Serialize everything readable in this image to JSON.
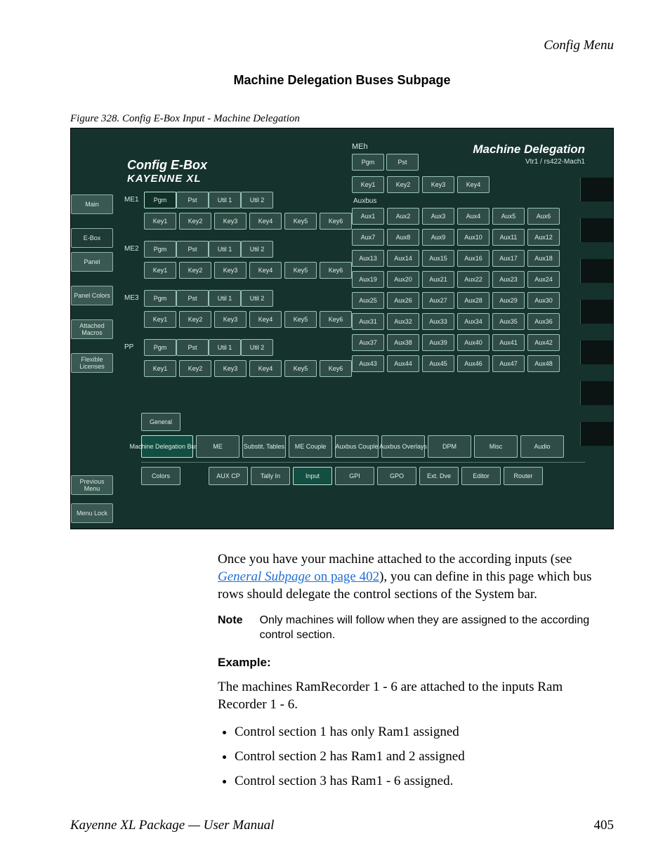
{
  "header": {
    "running": "Config Menu"
  },
  "section_title": "Machine Delegation Buses Subpage",
  "figure_caption": "Figure 328.  Config E-Box Input - Machine Delegation",
  "ui": {
    "title1": "Config E-Box",
    "title2": "KAYENNE XL",
    "sidebar": [
      "Main",
      "E-Box",
      "Panel",
      "Panel Colors",
      "Attached Macros",
      "Flexible Licenses"
    ],
    "sidebar_bottom": [
      "Previous Menu",
      "Menu Lock"
    ],
    "me_rows": [
      {
        "label": "ME1",
        "top": [
          "Pgm",
          "Pst",
          "Util 1",
          "Util 2"
        ],
        "keys": [
          "Key1",
          "Key2",
          "Key3",
          "Key4",
          "Key5",
          "Key6"
        ],
        "sel": 0
      },
      {
        "label": "ME2",
        "top": [
          "Pgm",
          "Pst",
          "Util 1",
          "Util 2"
        ],
        "keys": [
          "Key1",
          "Key2",
          "Key3",
          "Key4",
          "Key5",
          "Key6"
        ]
      },
      {
        "label": "ME3",
        "top": [
          "Pgm",
          "Pst",
          "Util 1",
          "Util 2"
        ],
        "keys": [
          "Key1",
          "Key2",
          "Key3",
          "Key4",
          "Key5",
          "Key6"
        ]
      },
      {
        "label": "PP",
        "top": [
          "Pgm",
          "Pst",
          "Util 1",
          "Util 2"
        ],
        "keys": [
          "Key1",
          "Key2",
          "Key3",
          "Key4",
          "Key5",
          "Key6"
        ]
      }
    ],
    "right": {
      "meh_label": "MEh",
      "pgm": "Pgm",
      "pst": "Pst",
      "title": "Machine Delegation",
      "subtitle": "Vtr1 / rs422-Mach1",
      "keys": [
        "Key1",
        "Key2",
        "Key3",
        "Key4"
      ],
      "aux_label": "Auxbus",
      "aux": [
        "Aux1",
        "Aux2",
        "Aux3",
        "Aux4",
        "Aux5",
        "Aux6",
        "Aux7",
        "Aux8",
        "Aux9",
        "Aux10",
        "Aux11",
        "Aux12",
        "Aux13",
        "Aux14",
        "Aux15",
        "Aux16",
        "Aux17",
        "Aux18",
        "Aux19",
        "Aux20",
        "Aux21",
        "Aux22",
        "Aux23",
        "Aux24",
        "Aux25",
        "Aux26",
        "Aux27",
        "Aux28",
        "Aux29",
        "Aux30",
        "Aux31",
        "Aux32",
        "Aux33",
        "Aux34",
        "Aux35",
        "Aux36",
        "Aux37",
        "Aux38",
        "Aux39",
        "Aux40",
        "Aux41",
        "Aux42",
        "Aux43",
        "Aux44",
        "Aux45",
        "Aux46",
        "Aux47",
        "Aux48"
      ]
    },
    "bottom": {
      "row1": [
        "General"
      ],
      "row2": [
        "Machine Delegation Buses",
        "ME",
        "Substit. Tables",
        "ME Couple",
        "Auxbus Couple",
        "Auxbus Overlays",
        "DPM",
        "Misc",
        "Audio"
      ],
      "row3": [
        "Colors",
        "AUX CP",
        "Tally In",
        "Input",
        "GPI",
        "GPO",
        "Ext. Dve",
        "Editor",
        "Router"
      ],
      "sel2": 0,
      "sel3": 3
    }
  },
  "para1a": "Once you have your machine attached to the according inputs (see ",
  "para1_link": "General Subpage",
  "para1_link2": " on page 402",
  "para1b": "), you can define in this page which bus rows should delegate the control sections of the System bar.",
  "note_label": "Note",
  "note_text": "Only machines will follow when they are assigned to the according control section.",
  "example_hd": "Example",
  "para2": "The machines RamRecorder 1 - 6 are attached to the inputs Ram Recorder 1 - 6.",
  "bullets": [
    "Control section 1 has only Ram1 assigned",
    "Control section 2 has Ram1 and 2 assigned",
    "Control section 3 has Ram1 - 6 assigned."
  ],
  "footer_left": "Kayenne XL Package — User Manual",
  "footer_right": "405"
}
